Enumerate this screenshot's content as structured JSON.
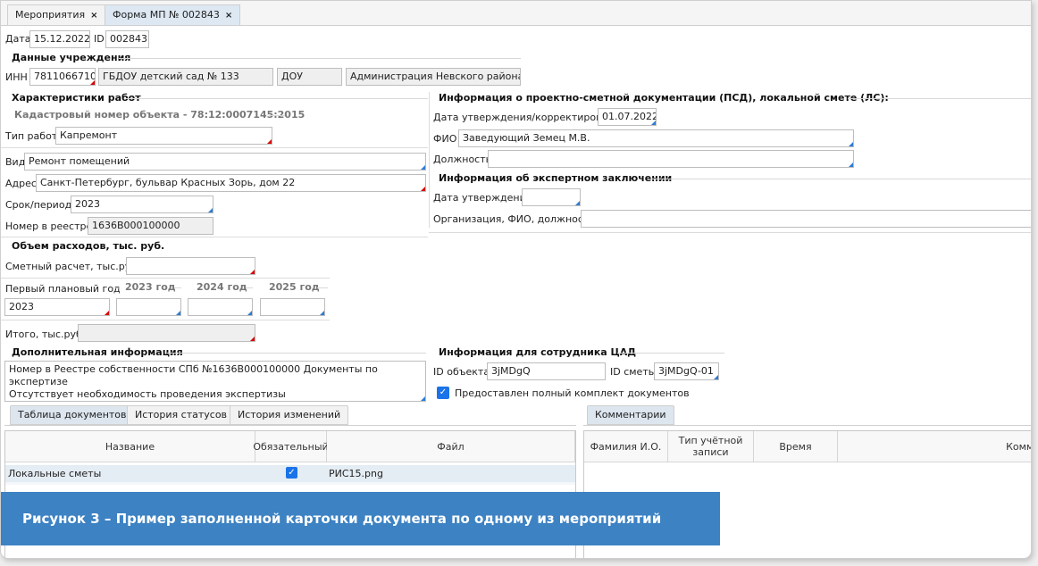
{
  "tabs": {
    "events": "Мероприятия",
    "form": "Форма МП № 002843",
    "close": "×"
  },
  "header": {
    "date_label": "Дата",
    "date_value": "15.12.2022",
    "id_label": "ID",
    "id_value": "002843"
  },
  "institution": {
    "title": "Данные учреждения",
    "inn_label": "ИНН",
    "inn_value": "7811066710",
    "name_value": "ГБДОУ детский сад № 133",
    "type_value": "ДОУ",
    "admin_value": "Администрация Невского района"
  },
  "works": {
    "title": "Характеристики работ",
    "cadastral": "Кадастровый номер объекта - 78:12:0007145:2015",
    "work_type_label": "Тип работ",
    "work_type_value": "Капремонт",
    "kind_label": "Вид",
    "kind_value": "Ремонт помещений",
    "address_label": "Адрес",
    "address_value": "Санкт-Петербург, бульвар Красных Зорь, дом 22",
    "period_label": "Срок/период",
    "period_value": "2023",
    "registry_label": "Номер в реестре",
    "registry_value": "1636B000100000"
  },
  "psd": {
    "title": "Информация о проектно-сметной документации (ПСД), локальной смете (ЛС):",
    "approval_label": "Дата утверждения/корректировки",
    "approval_value": "01.07.2022",
    "fio_label": "ФИО",
    "fio_value": "Заведующий Земец М.В.",
    "position_label": "Должность",
    "position_value": ""
  },
  "expert": {
    "title": "Информация об экспертном заключении",
    "approval_label": "Дата утверждения",
    "approval_value": "",
    "org_label": "Организация, ФИО, должность",
    "org_value": ""
  },
  "expenses": {
    "title": "Объем расходов, тыс. руб.",
    "estimate_label": "Сметный расчет, тыс.руб.",
    "estimate_value": "",
    "first_year_label": "Первый плановый год",
    "first_year_value": "2023",
    "year_2023": "2023 год",
    "year_2024": "2024 год",
    "year_2025": "2025 год",
    "v2023": "",
    "v2024": "",
    "v2025": "",
    "total_label": "Итого, тыс.руб.",
    "total_value": ""
  },
  "additional": {
    "title": "Дополнительная информация",
    "text_line1": "Номер в Реестре собственности СПб №1636B000100000 Документы по экспертизе",
    "text_line2": "Отсутствует необходимость проведения экспертизы"
  },
  "cad": {
    "title": "Информация для сотрудника ЦАД",
    "object_id_label": "ID объекта",
    "object_id_value": "3jMDgQ",
    "estimate_id_label": "ID сметы",
    "estimate_id_value": "3jMDgQ-01",
    "complete_label": "Предоставлен полный комплект документов",
    "complete_checked": true
  },
  "bottom_tabs": {
    "docs": "Таблица документов",
    "status_history": "История статусов",
    "change_history": "История изменений",
    "comments": "Комментарии"
  },
  "docs_table": {
    "columns": [
      "Название",
      "Обязательный",
      "Файл"
    ],
    "rows": [
      {
        "name": "Локальные сметы",
        "required": true,
        "file": "РИС15.png"
      }
    ]
  },
  "comments_table": {
    "columns": [
      "Фамилия И.О.",
      "Тип учётной записи",
      "Время",
      "Комме"
    ]
  },
  "caption": "Рисунок 3 – Пример заполненной карточки документа по одному из мероприятий",
  "colors": {
    "caption_bg": "#3d82c3",
    "required_marker": "#d80000",
    "optional_marker": "#2f7bd0",
    "checkbox": "#1a73e8"
  }
}
